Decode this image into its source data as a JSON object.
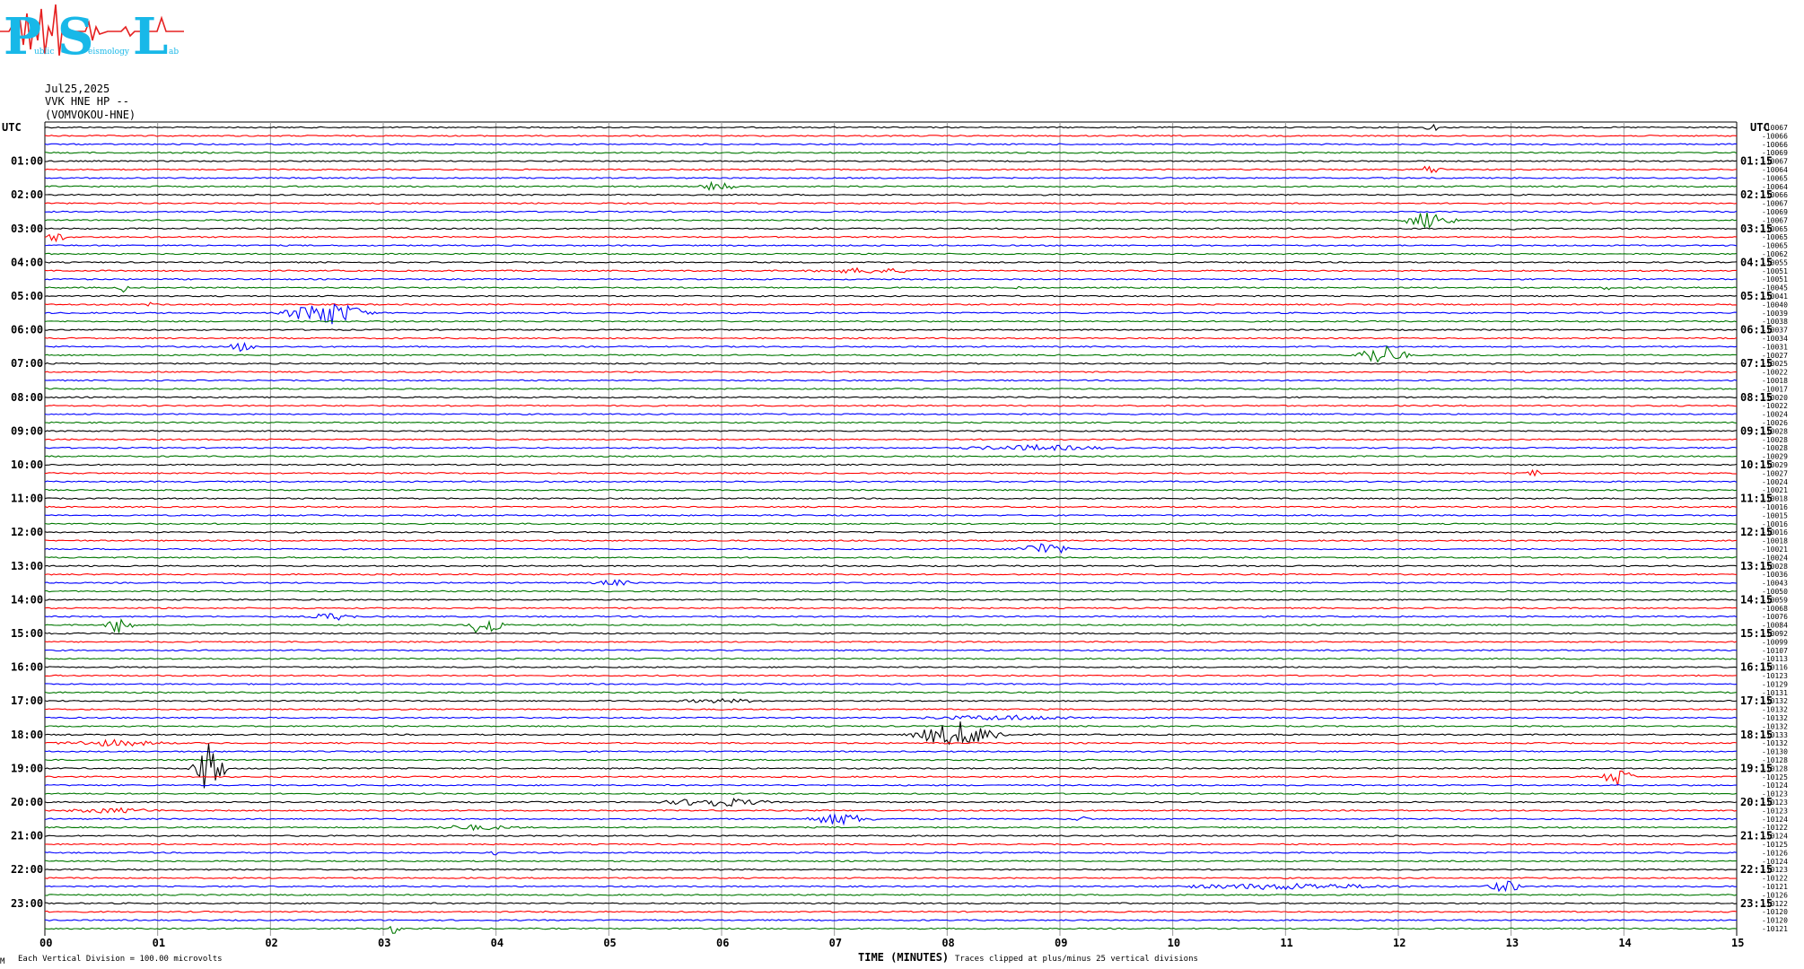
{
  "logo": {
    "big_letters": [
      "P",
      "S",
      "L"
    ],
    "small_text": [
      "ublic",
      "eismology",
      "ab"
    ]
  },
  "header": {
    "date": "Jul25,2025",
    "channel": "VVK HNE HP --",
    "station": "(VOMVOKOU-HNE)"
  },
  "left_axis_label": "UTC",
  "right_axis_label": "UTC",
  "left_hour_labels": [
    "01:00",
    "02:00",
    "03:00",
    "04:00",
    "05:00",
    "06:00",
    "07:00",
    "08:00",
    "09:00",
    "10:00",
    "11:00",
    "12:00",
    "13:00",
    "14:00",
    "15:00",
    "16:00",
    "17:00",
    "18:00",
    "19:00",
    "20:00",
    "21:00",
    "22:00",
    "23:00"
  ],
  "right_hour_labels": [
    "01:15",
    "02:15",
    "03:15",
    "04:15",
    "05:15",
    "06:15",
    "07:15",
    "08:15",
    "09:15",
    "10:15",
    "11:15",
    "12:15",
    "13:15",
    "14:15",
    "15:15",
    "16:15",
    "17:15",
    "18:15",
    "19:15",
    "20:15",
    "21:15",
    "22:15",
    "23:15"
  ],
  "x_tick_labels": [
    "00",
    "01",
    "02",
    "03",
    "04",
    "05",
    "06",
    "07",
    "08",
    "09",
    "10",
    "11",
    "12",
    "13",
    "14",
    "15"
  ],
  "footer": {
    "x_title": "TIME (MINUTES)",
    "scale_note": "Each Vertical Division =  100.00 microvolts",
    "clip_note": "Traces clipped at plus/minus 25 vertical divisions",
    "corner_mark": "M"
  },
  "chart_data": {
    "type": "line",
    "subtype": "helicorder",
    "x_range_minutes": [
      0,
      15
    ],
    "trace_minutes": 15,
    "trace_count": 96,
    "hours": 24,
    "trace_colors": [
      "#000000",
      "#ff0000",
      "#0000ff",
      "#007700"
    ],
    "grid": true,
    "offsets": [
      "-10067",
      "-10066",
      "-10066",
      "-10069",
      "-10067",
      "-10064",
      "-10065",
      "-10064",
      "-10066",
      "-10067",
      "-10069",
      "-10067",
      "-10065",
      "-10065",
      "-10065",
      "-10062",
      "-10055",
      "-10051",
      "-10051",
      "-10045",
      "-10041",
      "-10040",
      "-10039",
      "-10038",
      "-10037",
      "-10034",
      "-10031",
      "-10027",
      "-10025",
      "-10022",
      "-10018",
      "-10017",
      "-10020",
      "-10022",
      "-10024",
      "-10026",
      "-10028",
      "-10028",
      "-10028",
      "-10029",
      "-10029",
      "-10027",
      "-10024",
      "-10021",
      "-10018",
      "-10016",
      "-10015",
      "-10016",
      "-10016",
      "-10018",
      "-10021",
      "-10024",
      "-10028",
      "-10036",
      "-10043",
      "-10050",
      "-10059",
      "-10068",
      "-10076",
      "-10084",
      "-10092",
      "-10099",
      "-10107",
      "-10113",
      "-10116",
      "-10123",
      "-10129",
      "-10131",
      "-10132",
      "-10132",
      "-10132",
      "-10132",
      "-10133",
      "-10132",
      "-10130",
      "-10128",
      "-10128",
      "-10125",
      "-10124",
      "-10123",
      "-10123",
      "-10123",
      "-10124",
      "-10122",
      "-10124",
      "-10125",
      "-10126",
      "-10124",
      "-10123",
      "-10122",
      "-10121",
      "-10126",
      "-10122",
      "-10120",
      "-10120",
      "-10121"
    ],
    "events": [
      {
        "trace": 0,
        "minute": 12.3,
        "amp": 1.4,
        "dur": 0.08
      },
      {
        "trace": 5,
        "minute": 12.28,
        "amp": 1.5,
        "dur": 0.15
      },
      {
        "trace": 7,
        "minute": 5.97,
        "amp": 2.0,
        "dur": 0.18
      },
      {
        "trace": 11,
        "minute": 12.28,
        "amp": 3.2,
        "dur": 0.28
      },
      {
        "trace": 12,
        "minute": 13.0,
        "amp": 0.8,
        "dur": 0.05
      },
      {
        "trace": 13,
        "minute": 0.1,
        "amp": 2.2,
        "dur": 0.1
      },
      {
        "trace": 17,
        "minute": 7.3,
        "amp": 0.9,
        "dur": 0.6
      },
      {
        "trace": 19,
        "minute": 0.7,
        "amp": 1.5,
        "dur": 0.06
      },
      {
        "trace": 19,
        "minute": 8.6,
        "amp": 1.2,
        "dur": 0.06
      },
      {
        "trace": 19,
        "minute": 13.85,
        "amp": 1.2,
        "dur": 0.06
      },
      {
        "trace": 21,
        "minute": 0.95,
        "amp": 1.0,
        "dur": 0.05
      },
      {
        "trace": 22,
        "minute": 2.5,
        "amp": 4.5,
        "dur": 0.45
      },
      {
        "trace": 26,
        "minute": 1.75,
        "amp": 1.8,
        "dur": 0.14
      },
      {
        "trace": 27,
        "minute": 11.85,
        "amp": 3.8,
        "dur": 0.28
      },
      {
        "trace": 38,
        "minute": 8.8,
        "amp": 0.9,
        "dur": 0.8
      },
      {
        "trace": 41,
        "minute": 13.2,
        "amp": 1.2,
        "dur": 0.08
      },
      {
        "trace": 50,
        "minute": 8.85,
        "amp": 2.4,
        "dur": 0.28
      },
      {
        "trace": 54,
        "minute": 5.05,
        "amp": 1.0,
        "dur": 0.22
      },
      {
        "trace": 58,
        "minute": 2.55,
        "amp": 1.3,
        "dur": 0.25
      },
      {
        "trace": 59,
        "minute": 0.68,
        "amp": 3.6,
        "dur": 0.16
      },
      {
        "trace": 59,
        "minute": 3.9,
        "amp": 4.0,
        "dur": 0.2
      },
      {
        "trace": 68,
        "minute": 6.0,
        "amp": 0.6,
        "dur": 0.5
      },
      {
        "trace": 70,
        "minute": 8.5,
        "amp": 0.8,
        "dur": 0.9
      },
      {
        "trace": 72,
        "minute": 8.1,
        "amp": 4.5,
        "dur": 0.5
      },
      {
        "trace": 73,
        "minute": 0.6,
        "amp": 1.0,
        "dur": 0.6
      },
      {
        "trace": 76,
        "minute": 1.45,
        "amp": 9.0,
        "dur": 0.18
      },
      {
        "trace": 77,
        "minute": 13.95,
        "amp": 3.5,
        "dur": 0.16
      },
      {
        "trace": 80,
        "minute": 5.95,
        "amp": 1.6,
        "dur": 0.55
      },
      {
        "trace": 81,
        "minute": 0.6,
        "amp": 0.8,
        "dur": 0.5
      },
      {
        "trace": 82,
        "minute": 7.05,
        "amp": 2.0,
        "dur": 0.35
      },
      {
        "trace": 82,
        "minute": 9.2,
        "amp": 0.8,
        "dur": 0.1
      },
      {
        "trace": 83,
        "minute": 3.8,
        "amp": 0.8,
        "dur": 0.5
      },
      {
        "trace": 86,
        "minute": 4.0,
        "amp": 1.0,
        "dur": 0.05
      },
      {
        "trace": 90,
        "minute": 11.0,
        "amp": 1.0,
        "dur": 1.2
      },
      {
        "trace": 90,
        "minute": 12.95,
        "amp": 2.0,
        "dur": 0.2
      },
      {
        "trace": 95,
        "minute": 3.1,
        "amp": 2.5,
        "dur": 0.08
      }
    ]
  }
}
